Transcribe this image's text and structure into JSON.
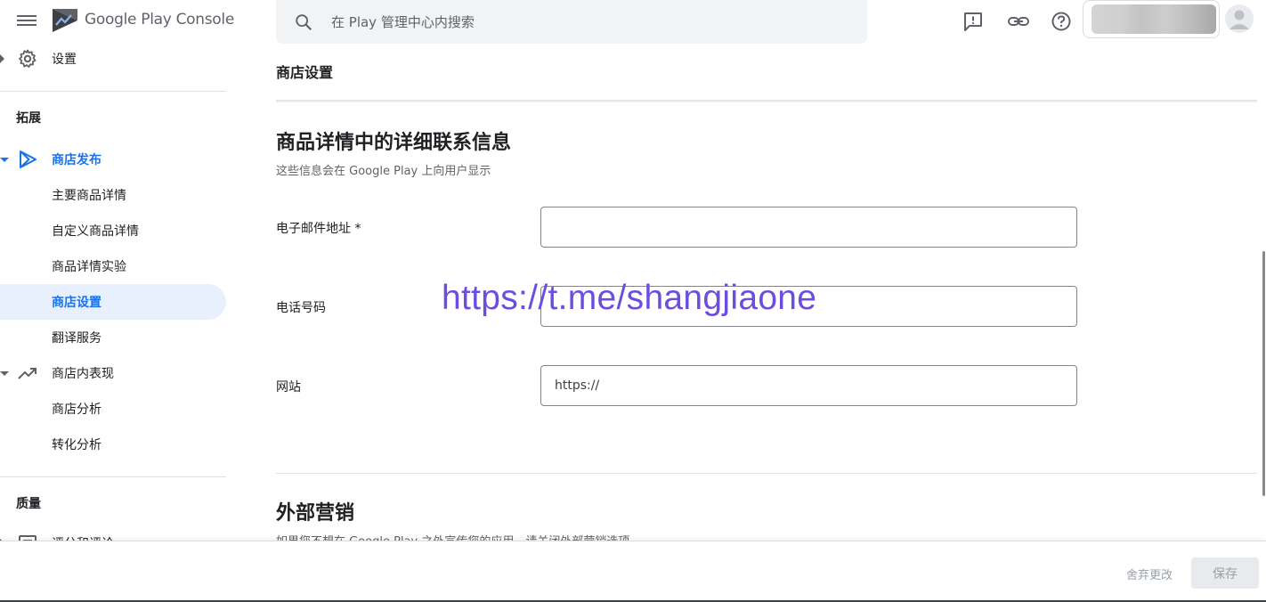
{
  "header": {
    "brand": "Google Play Console",
    "search_placeholder": "在 Play 管理中心内搜索"
  },
  "sidebar": {
    "settings_label": "设置",
    "section_grow": "拓展",
    "store_presence": "商店发布",
    "sub_items": [
      "主要商品详情",
      "自定义商品详情",
      "商品详情实验",
      "商店设置",
      "翻译服务"
    ],
    "store_performance": "商店内表现",
    "perf_items": [
      "商店分析",
      "转化分析"
    ],
    "section_quality": "质量",
    "ratings_reviews": "评分和评论"
  },
  "main": {
    "page_title": "商店设置",
    "contact_section": {
      "title": "商品详情中的详细联系信息",
      "description": "这些信息会在 Google Play 上向用户显示",
      "email_label": "电子邮件地址 *",
      "phone_label": "电话号码",
      "website_label": "网站",
      "website_placeholder": "https://"
    },
    "marketing_section": {
      "title": "外部营销",
      "description": "如果您不想在 Google Play 之外宣传您的应用，请关闭外部营销选项"
    }
  },
  "overlay": {
    "watermark": "https://t.me/shangjiaone"
  },
  "footer": {
    "discard_label": "舍弃更改",
    "save_label": "保存"
  },
  "colors": {
    "accent": "#1a73e8",
    "selected_bg": "#e8f0fe",
    "watermark": "#6b4ee0"
  }
}
